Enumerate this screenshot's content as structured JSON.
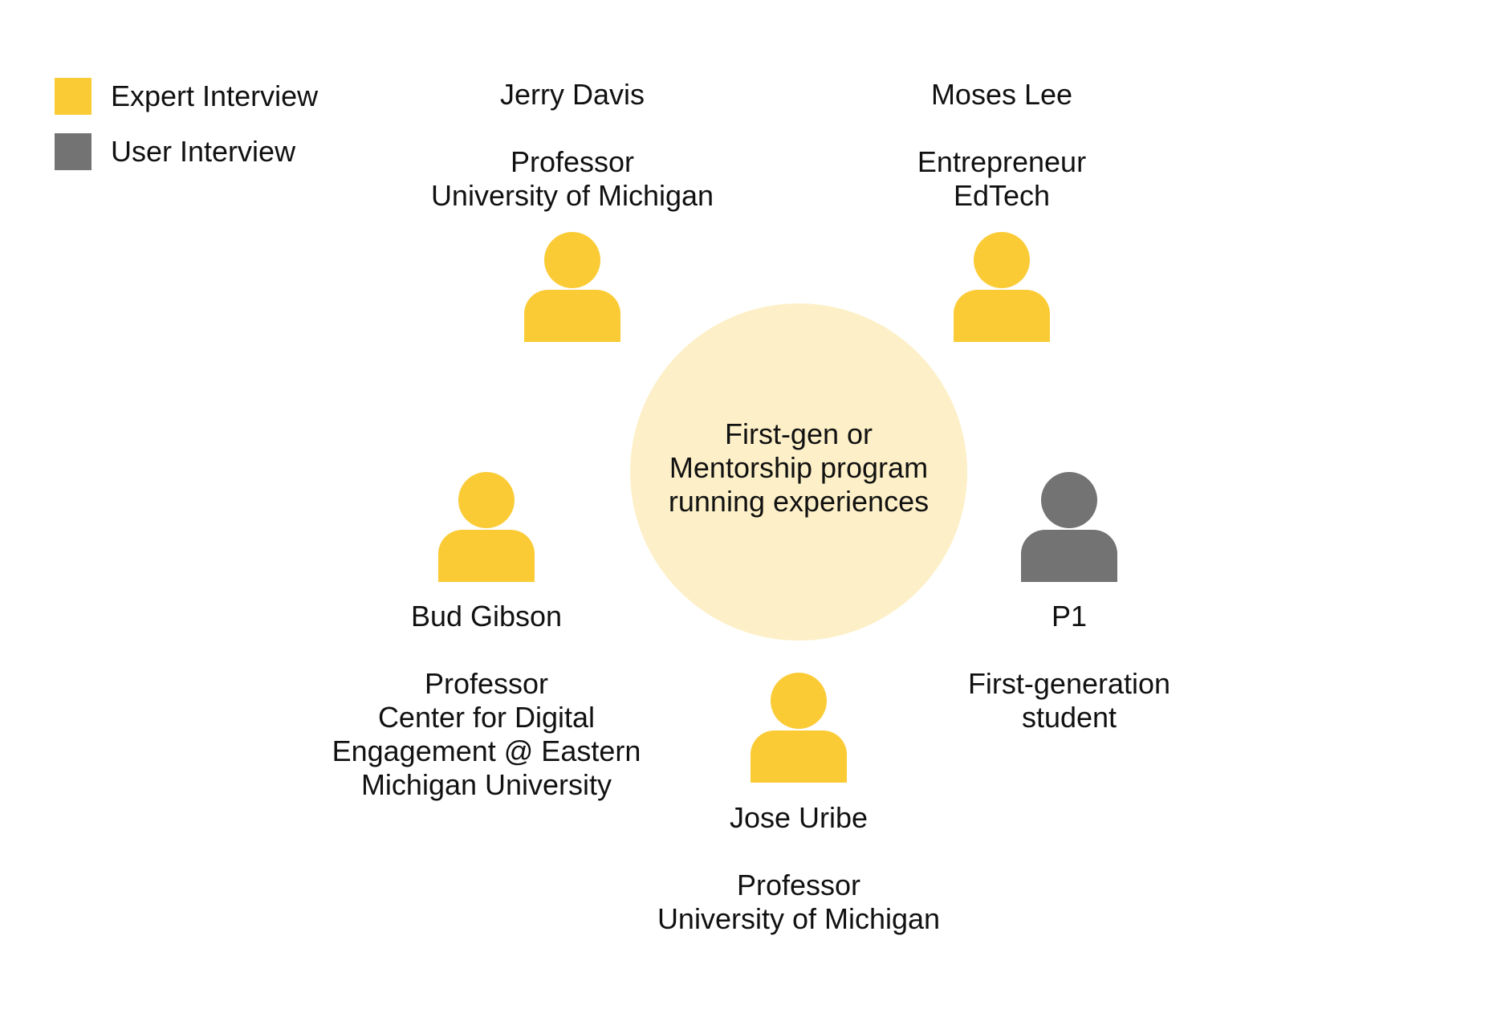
{
  "colors": {
    "expert": "#FBCB36",
    "user": "#737373",
    "center_fill": "#FDF0C8",
    "text": "#111111"
  },
  "legend": {
    "expert_label": "Expert Interview",
    "user_label": "User Interview"
  },
  "center": {
    "lines": [
      "First-gen or",
      "Mentorship program",
      "running experiences"
    ]
  },
  "people": {
    "jerry": {
      "type": "expert",
      "name": "Jerry Davis",
      "lines": [
        "Professor",
        "University of Michigan"
      ]
    },
    "moses": {
      "type": "expert",
      "name": "Moses Lee",
      "lines": [
        "Entrepreneur",
        "EdTech"
      ]
    },
    "bud": {
      "type": "expert",
      "name": "Bud Gibson",
      "lines": [
        "Professor",
        "Center for Digital",
        "Engagement @ Eastern",
        "Michigan University"
      ]
    },
    "p1": {
      "type": "user",
      "name": "P1",
      "lines": [
        "First-generation",
        "student"
      ]
    },
    "jose": {
      "type": "expert",
      "name": "Jose Uribe",
      "lines": [
        "Professor",
        "University of Michigan"
      ]
    }
  }
}
